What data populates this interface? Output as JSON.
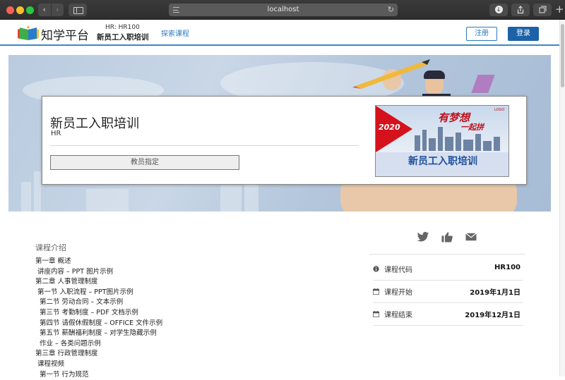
{
  "browser": {
    "url": "localhost"
  },
  "header": {
    "logo_text": "知学平台",
    "course_id": "HR: HR100",
    "course_title": "新员工入职培训",
    "explore_link": "探索课程",
    "register_label": "注册",
    "login_label": "登录"
  },
  "hero": {
    "title": "新员工入职培训",
    "subtitle": "HR",
    "enroll_label": "教员指定",
    "thumbnail": {
      "year": "2020",
      "slogan_line1": "有梦想",
      "slogan_line2": "一起拼",
      "logo": "LOGO",
      "name": "新员工入职培训"
    }
  },
  "intro": {
    "heading": "课程介绍",
    "toc": [
      "第一章 概述",
      " 讲座内容 – PPT 图片示例",
      "第二章 人事管理制度",
      " 第一节 入职流程 – PPT图片示例",
      "  第二节 劳动合同 – 文本示例",
      "  第三节 考勤制度 – PDF 文档示例",
      "  第四节 请假休假制度 – OFFICE 文件示例",
      "  第五节 薪酬福利制度 – 对学生隐藏示例",
      "  作业 – 各类问题示例",
      "第三章 行政管理制度",
      " 课程视频",
      "  第一节 行为规范"
    ]
  },
  "social": {
    "icons": [
      "twitter-icon",
      "thumbs-up-icon",
      "email-icon"
    ]
  },
  "meta": [
    {
      "icon": "info-icon",
      "label": "课程代码",
      "value": "HR100"
    },
    {
      "icon": "calendar-icon",
      "label": "课程开始",
      "value": "2019年1月1日"
    },
    {
      "icon": "calendar-icon",
      "label": "课程结束",
      "value": "2019年12月1日"
    }
  ],
  "colors": {
    "primary": "#1b62a8",
    "link": "#2a7bbf",
    "accent_red": "#d5121b"
  }
}
